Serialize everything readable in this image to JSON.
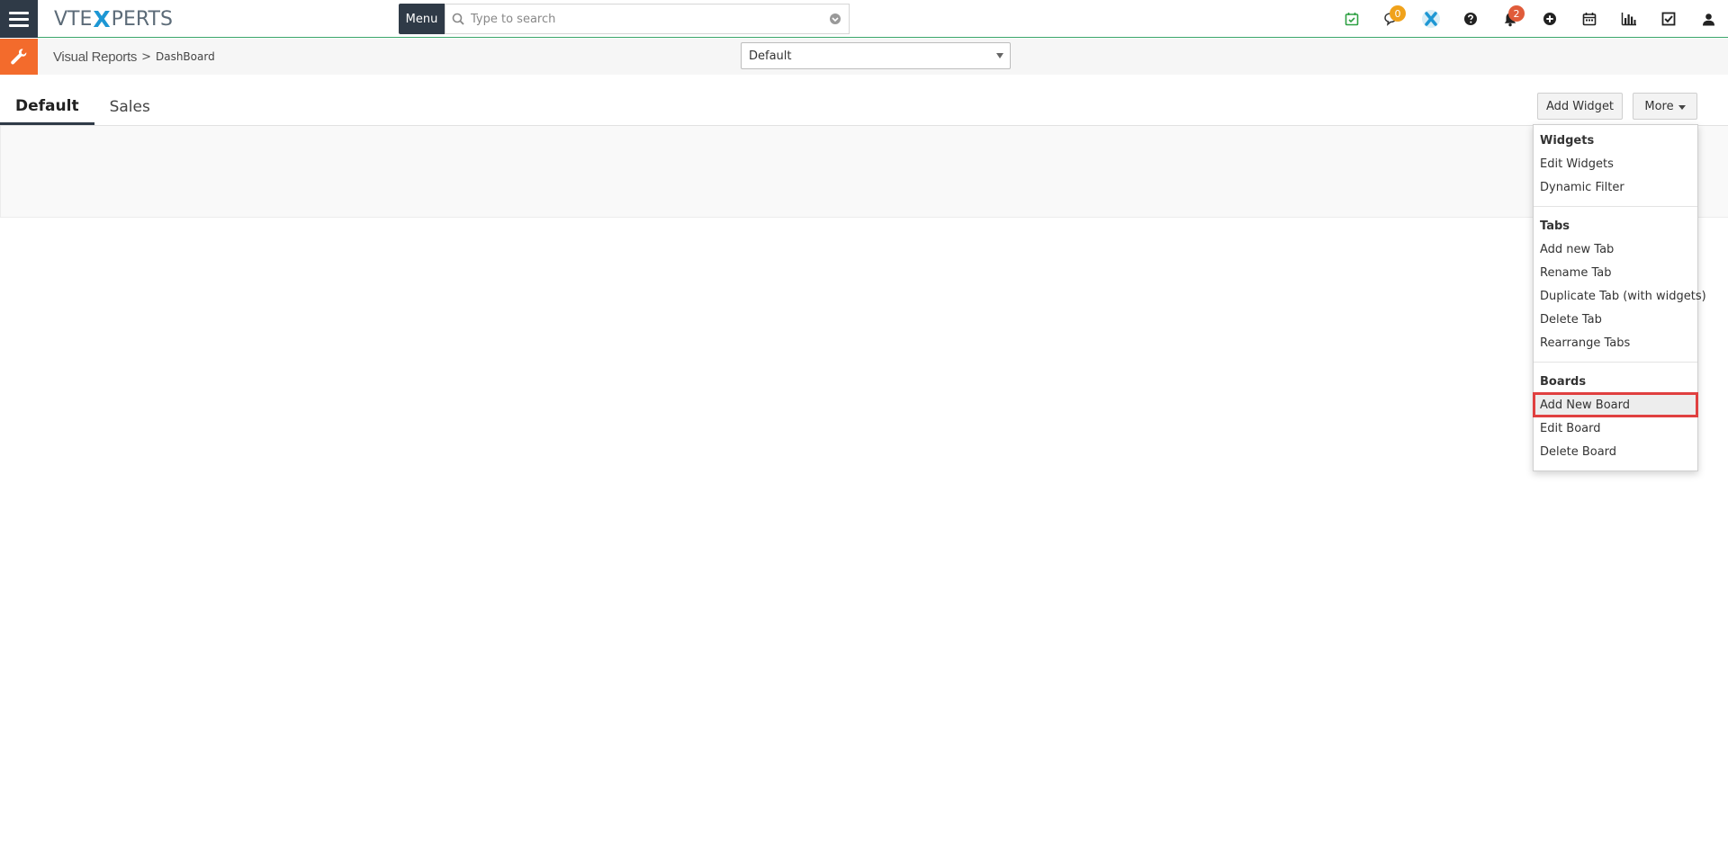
{
  "topbar": {
    "logo": {
      "part1": "VTE",
      "part2": "X",
      "part3": "PERTS"
    },
    "menu_label": "Menu",
    "search_placeholder": "Type to search",
    "icons": [
      {
        "name": "calendar-check-icon",
        "color": "#2ea043"
      },
      {
        "name": "chat-icon",
        "badge": "0",
        "badge_color": "#f0a21b"
      },
      {
        "name": "vtexperts-x-icon",
        "color": "#1d97d4"
      },
      {
        "name": "help-icon"
      },
      {
        "name": "bell-icon",
        "badge": "2",
        "badge_color": "#e05c3a"
      },
      {
        "name": "add-circle-icon"
      },
      {
        "name": "calendar-icon"
      },
      {
        "name": "bar-chart-icon"
      },
      {
        "name": "task-check-icon"
      },
      {
        "name": "user-icon"
      }
    ]
  },
  "subbar": {
    "module": "Visual Reports",
    "separator": ">",
    "page": "DashBoard",
    "board_selected": "Default"
  },
  "tabs": [
    {
      "label": "Default",
      "active": true
    },
    {
      "label": "Sales",
      "active": false
    }
  ],
  "actions": {
    "add_widget": "Add Widget",
    "more": "More"
  },
  "dropdown": {
    "widgets_header": "Widgets",
    "widgets_items": [
      "Edit Widgets",
      "Dynamic Filter"
    ],
    "tabs_header": "Tabs",
    "tabs_items": [
      "Add new Tab",
      "Rename Tab",
      "Duplicate Tab (with widgets)",
      "Delete Tab",
      "Rearrange Tabs"
    ],
    "boards_header": "Boards",
    "boards_items": [
      "Add New Board",
      "Edit Board",
      "Delete Board"
    ],
    "highlighted": "Add New Board"
  },
  "colors": {
    "navy": "#2f3a47",
    "accent_orange": "#f36b2c",
    "topbar_line": "#3aa56a",
    "highlight_border": "#e04040"
  }
}
